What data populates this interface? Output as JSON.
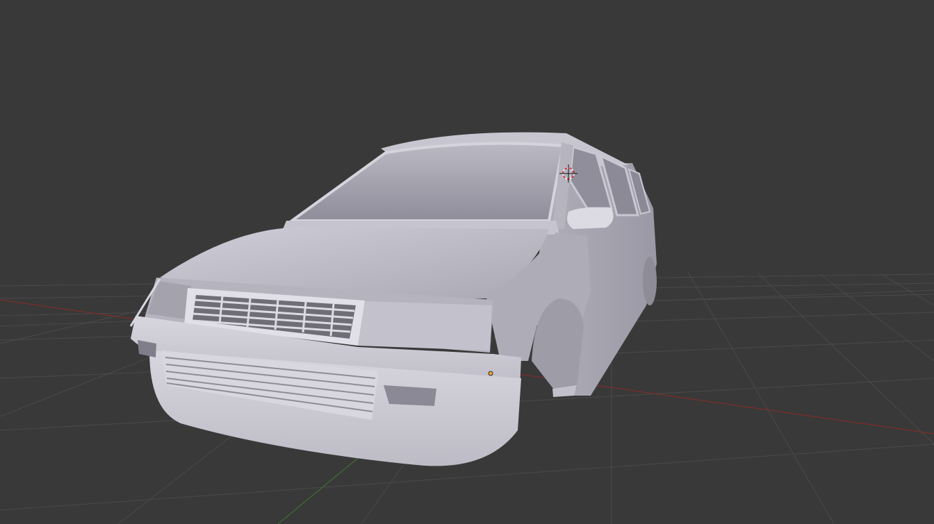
{
  "viewport": {
    "background": "#393939",
    "grid_color": "#4a4a4a",
    "x_axis_color": "#8c2a2a",
    "y_axis_color": "#3b7a2a",
    "cursor_icon": "3d-cursor-icon",
    "origin_icon": "object-origin-icon",
    "model_color": "#b9b8c2"
  }
}
